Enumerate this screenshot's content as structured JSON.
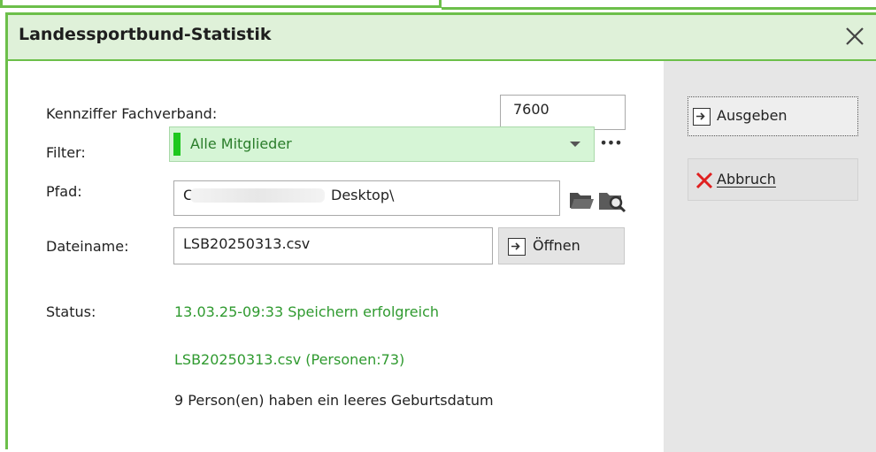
{
  "dialog": {
    "title": "Landessportbund-Statistik"
  },
  "form": {
    "kennziffer_label": "Kennziffer Fachverband:",
    "kennziffer_value": "7600",
    "filter_label": "Filter:",
    "filter_value": "Alle Mitglieder",
    "filter_more": "•••",
    "pfad_label": "Pfad:",
    "pfad_prefix": "C:\\",
    "pfad_suffix": "Desktop\\",
    "dateiname_label": "Dateiname:",
    "dateiname_value": "LSB20250313.csv",
    "open_label": "Öffnen"
  },
  "buttons": {
    "ausgeben_label": "Ausgeben",
    "abbruch_label": "Abbruch"
  },
  "status": {
    "label": "Status:",
    "line1": "13.03.25-09:33 Speichern erfolgreich",
    "line2": "LSB20250313.csv (Personen:73)",
    "line3": "9 Person(en) haben ein leeres Geburtsdatum"
  },
  "colors": {
    "accent_green": "#6cbf4a",
    "titlebar_bg": "#dff1d9",
    "filter_bg": "#d6f5d6",
    "filter_marker": "#1ec81e",
    "status_green": "#2f9a2f",
    "cancel_red": "#e02020"
  },
  "icons": {
    "close": "close-icon",
    "dropdown": "chevron-down-icon",
    "folder": "folder-icon",
    "browse": "folder-search-icon",
    "export": "arrow-into-box-icon",
    "cancel": "red-x-icon"
  }
}
